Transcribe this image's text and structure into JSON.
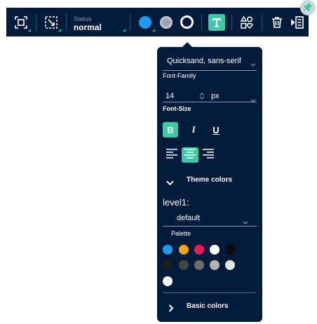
{
  "toolbar": {
    "status_label": "Status",
    "status_value": "normal",
    "colors": {
      "fill": "#1c9cf0",
      "accent": "#3cc9a3",
      "background": "#021b3a"
    },
    "icons": [
      "select-frame-icon",
      "select-dashed-icon",
      "fill-color-icon",
      "blur-icon",
      "border-icon",
      "text-icon",
      "shapes-icon",
      "trash-icon",
      "insert-after-icon",
      "pin-icon"
    ]
  },
  "panel": {
    "font_family_value": "Quicksand, sans-serif",
    "font_family_label": "Font-Family",
    "font_size_value": "14",
    "font_size_unit": "px",
    "font_size_label": "Font-Size",
    "bold_label": "B",
    "italic_label": "I",
    "underline_label": "U",
    "theme_colors_label": "Theme colors",
    "level_label": "level1:",
    "level_value": "default",
    "palette_label": "Palette",
    "palette_colors": [
      "#1c9cf0",
      "#f8a218",
      "#f0195c",
      "#ffffff",
      "#0a0a0a",
      "#1d1d1d",
      "#454545",
      "#6c6c6c",
      "#b4b4b4",
      "#e4e4e4",
      "#ffffff"
    ],
    "basic_colors_label": "Basic colors"
  }
}
